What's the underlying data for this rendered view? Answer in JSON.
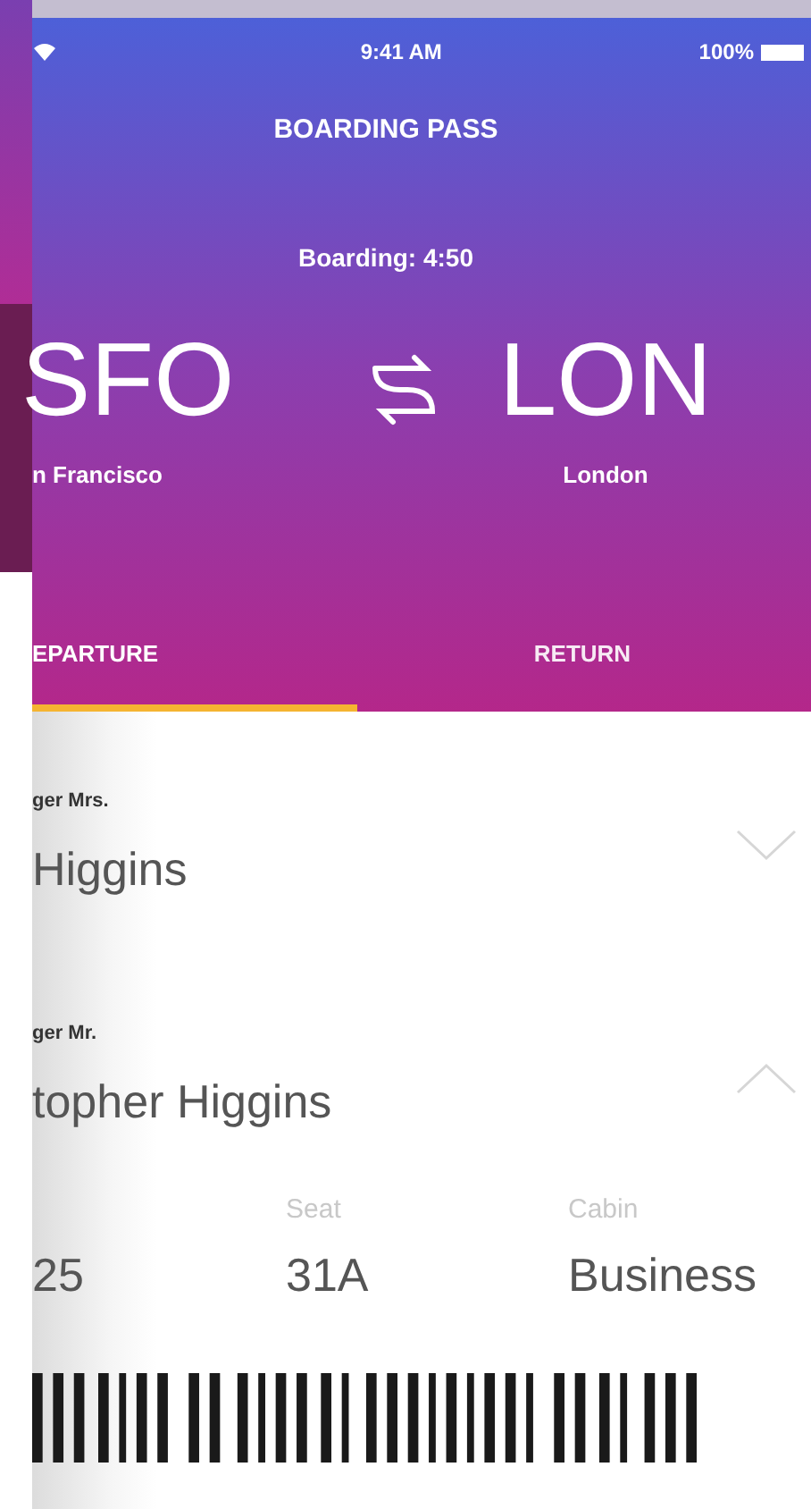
{
  "status_bar": {
    "time": "9:41 AM",
    "battery": "100%"
  },
  "header": {
    "title": "BOARDING PASS",
    "boarding": "Boarding: 4:50"
  },
  "route": [
    {
      "code": "SFO",
      "city": "n Francisco"
    },
    {
      "code": "LON",
      "city": "London"
    }
  ],
  "tabs": [
    {
      "label": "EPARTURE",
      "selected": true
    },
    {
      "label": "RETURN",
      "selected": false
    }
  ],
  "passengers": [
    {
      "label": "ger Mrs.",
      "name": "Higgins",
      "expanded": false
    },
    {
      "label": "ger Mr.",
      "name": "topher Higgins",
      "expanded": true
    }
  ],
  "details": [
    {
      "value": "25"
    },
    {
      "label": "Seat",
      "value": "31A"
    },
    {
      "label": "Cabin",
      "value": "Business"
    }
  ]
}
